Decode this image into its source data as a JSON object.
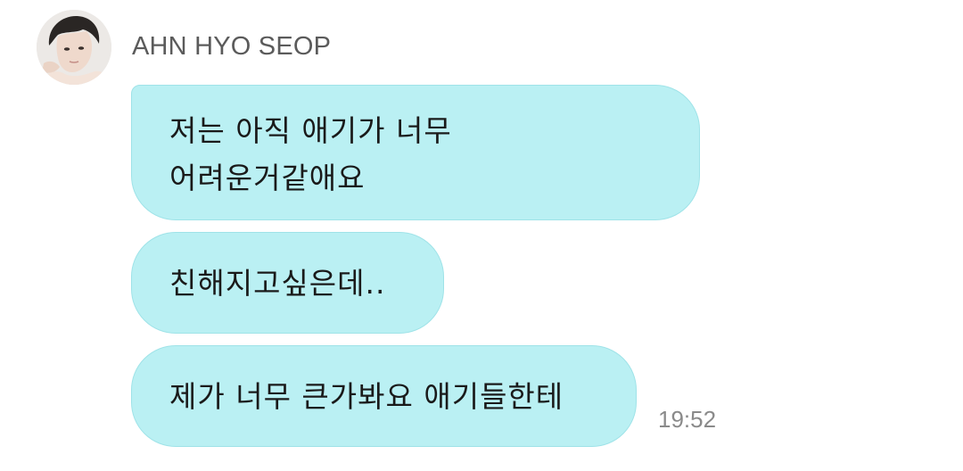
{
  "sender": {
    "name": "AHN HYO SEOP",
    "avatar_icon": "profile-photo"
  },
  "messages": [
    {
      "lines": [
        "저는 아직 애기가 너무",
        "어려운거같애요"
      ]
    },
    {
      "lines": [
        "친해지고싶은데.."
      ]
    },
    {
      "lines": [
        "제가 너무 큰가봐요 애기들한테"
      ]
    }
  ],
  "timestamp": "19:52",
  "colors": {
    "bubble": "#baf0f3",
    "bubble_border": "#9fe3e8",
    "sender_text": "#5b5b5b",
    "timestamp_text": "#8a8a8a"
  }
}
